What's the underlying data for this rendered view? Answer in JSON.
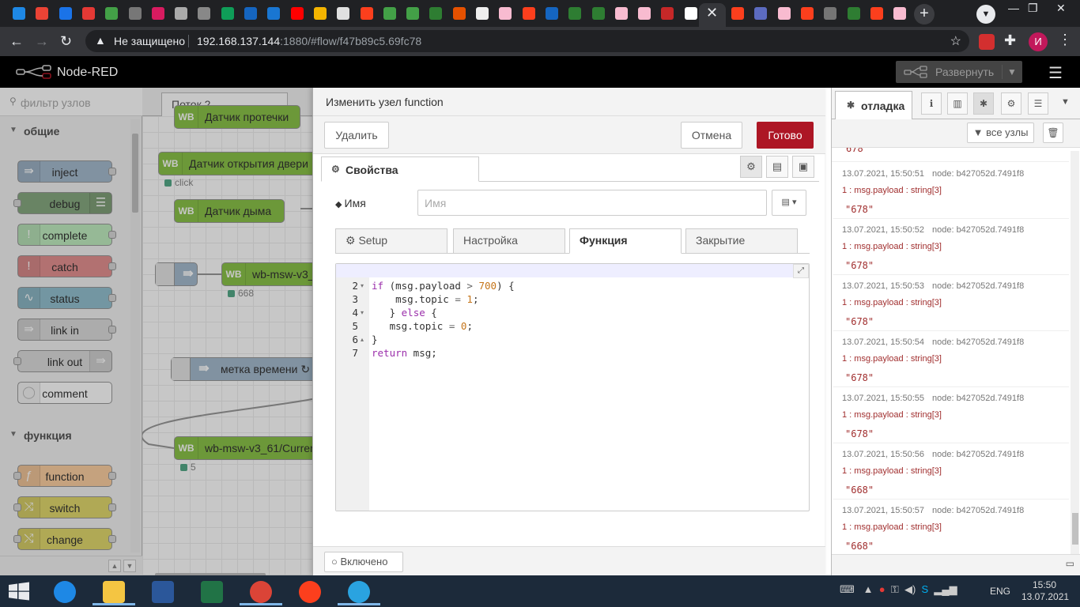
{
  "browser": {
    "security_label": "Не защищено",
    "url_host": "192.168.137.144",
    "url_rest": ":1880/#flow/f47b89c5.69fc78",
    "profile_initial": "И",
    "tab_favicon_colors": [
      "#1e88e5",
      "#ea4335",
      "#1a73e8",
      "#e53935",
      "#43a047",
      "#777777",
      "#d81b60",
      "#aaaaaa",
      "#888888",
      "#0f9d58",
      "#1565c0",
      "#1976d2",
      "#ff0000",
      "#f4b400",
      "#e0e0e0",
      "#fc3f1d",
      "#43a047",
      "#43a047",
      "#2e7d32",
      "#e65100",
      "#eeeeee",
      "#f8bbd0",
      "#fc3f1d",
      "#1565c0",
      "#2e7d32",
      "#2e7d32",
      "#f8bbd0",
      "#f8bbd0",
      "#c62828",
      "#ffffff",
      "#fc3f1d",
      "#5c6bc0",
      "#f8bbd0",
      "#fc3f1d",
      "#757575",
      "#2e7d32",
      "#fc3f1d",
      "#f8bbd0"
    ]
  },
  "header": {
    "title": "Node-RED",
    "deploy_label": "Развернуть"
  },
  "palette": {
    "filter_placeholder": "фильтр узлов",
    "categories": [
      {
        "label": "общие"
      },
      {
        "label": "функция"
      }
    ],
    "nodes": [
      {
        "label": "inject",
        "color": "#a6bbcf"
      },
      {
        "label": "debug",
        "color": "#87a980"
      },
      {
        "label": "complete",
        "color": "#c0edc0"
      },
      {
        "label": "catch",
        "color": "#e49191"
      },
      {
        "label": "status",
        "color": "#94c1d0"
      },
      {
        "label": "link in",
        "color": "#dddddd"
      },
      {
        "label": "link out",
        "color": "#dddddd"
      },
      {
        "label": "comment",
        "color": "#ffffff"
      },
      {
        "label": "function",
        "color": "#fdd0a2"
      },
      {
        "label": "switch",
        "color": "#e2d96e"
      },
      {
        "label": "change",
        "color": "#e2d96e"
      }
    ]
  },
  "workspace": {
    "tab_label": "Поток 2",
    "nodes": [
      {
        "label": "Датчик протечки",
        "icon": "WB"
      },
      {
        "label": "Датчик открытия двери",
        "icon": "WB"
      },
      {
        "label": "Датчик дыма",
        "icon": "WB"
      },
      {
        "label": "wb-msw-v3_",
        "icon": "WB"
      },
      {
        "label": "метка времени ↻",
        "icon": ""
      },
      {
        "label": "wb-msw-v3_61/Curren",
        "icon": "WB"
      }
    ],
    "statuses": [
      "click",
      "668",
      "5"
    ]
  },
  "tray": {
    "title": "Изменить узел function",
    "delete_label": "Удалить",
    "cancel_label": "Отмена",
    "done_label": "Готово",
    "properties_tab": "Свойства",
    "name_label": "Имя",
    "name_placeholder": "Имя",
    "subtabs": [
      "Setup",
      "Настройка",
      "Функция",
      "Закрытие"
    ],
    "active_subtab": "Функция",
    "code_lines": [
      "",
      "if (msg.payload > 700) {",
      "    msg.topic = 1;",
      "   } else {",
      "   msg.topic = 0;",
      "}",
      "return msg;"
    ],
    "enabled_label": "Включено"
  },
  "sidebar": {
    "debug_tab": "отладка",
    "filter_label": "все узлы",
    "partial_value": "678",
    "messages": [
      {
        "time": "13.07.2021, 15:50:51",
        "node": "node: b427052d.7491f8",
        "topic": "1 : msg.payload : string[3]",
        "value": "\"678\""
      },
      {
        "time": "13.07.2021, 15:50:52",
        "node": "node: b427052d.7491f8",
        "topic": "1 : msg.payload : string[3]",
        "value": "\"678\""
      },
      {
        "time": "13.07.2021, 15:50:53",
        "node": "node: b427052d.7491f8",
        "topic": "1 : msg.payload : string[3]",
        "value": "\"678\""
      },
      {
        "time": "13.07.2021, 15:50:54",
        "node": "node: b427052d.7491f8",
        "topic": "1 : msg.payload : string[3]",
        "value": "\"678\""
      },
      {
        "time": "13.07.2021, 15:50:55",
        "node": "node: b427052d.7491f8",
        "topic": "1 : msg.payload : string[3]",
        "value": "\"678\""
      },
      {
        "time": "13.07.2021, 15:50:56",
        "node": "node: b427052d.7491f8",
        "topic": "1 : msg.payload : string[3]",
        "value": "\"668\""
      },
      {
        "time": "13.07.2021, 15:50:57",
        "node": "node: b427052d.7491f8",
        "topic": "1 : msg.payload : string[3]",
        "value": "\"668\""
      }
    ]
  },
  "taskbar": {
    "lang": "ENG",
    "time": "15:50",
    "date": "13.07.2021",
    "apps": [
      {
        "name": "internet-explorer",
        "color": "#1e88e5",
        "open": false
      },
      {
        "name": "file-explorer",
        "color": "#f4c542",
        "open": true
      },
      {
        "name": "word",
        "color": "#2b579a",
        "open": false
      },
      {
        "name": "excel",
        "color": "#217346",
        "open": false
      },
      {
        "name": "chrome",
        "color": "#db4437",
        "open": true
      },
      {
        "name": "yandex-browser",
        "color": "#fc3f1d",
        "open": false
      },
      {
        "name": "telegram",
        "color": "#2aa3e0",
        "open": true
      }
    ]
  }
}
